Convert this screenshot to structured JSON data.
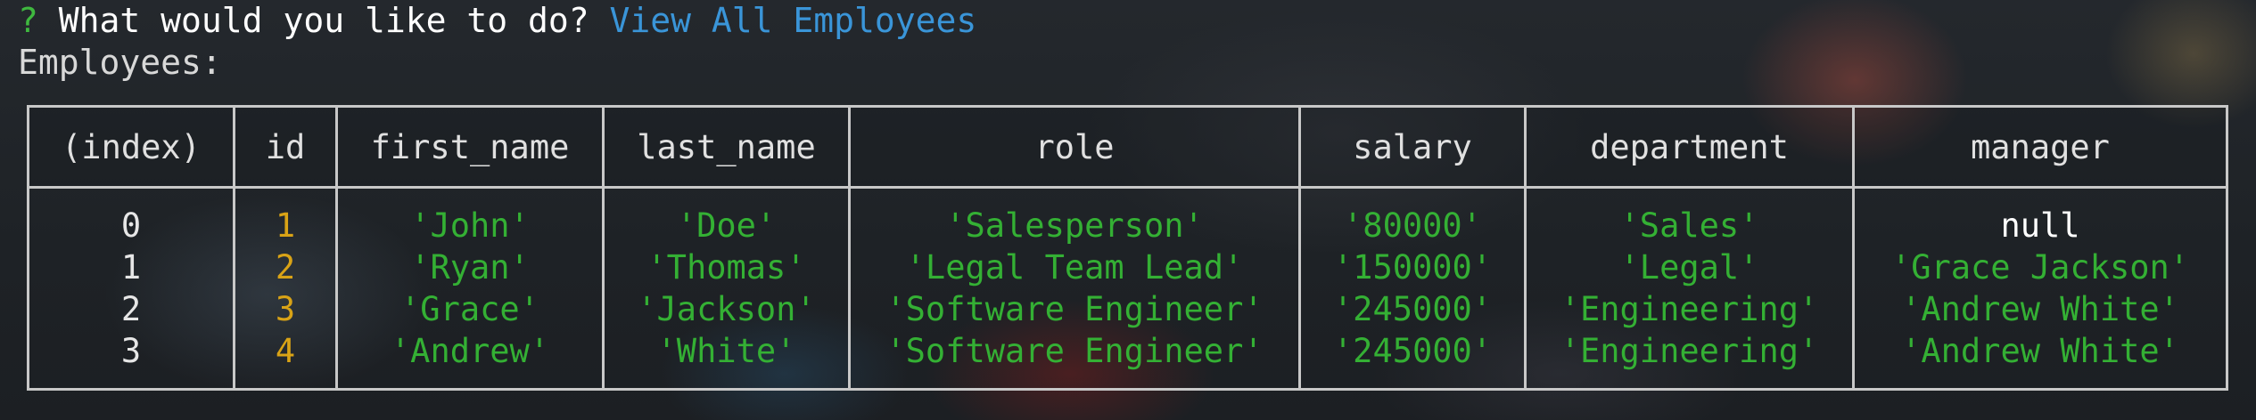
{
  "terminal": {
    "prompt_mark": "?",
    "prompt_question": "What would you like to do?",
    "prompt_answer": "View All Employees",
    "heading": "Employees:"
  },
  "table": {
    "columns": [
      "(index)",
      "id",
      "first_name",
      "last_name",
      "role",
      "salary",
      "department",
      "manager"
    ],
    "rows": [
      {
        "index": "0",
        "id": "1",
        "first_name": "'John'",
        "last_name": "'Doe'",
        "role": "'Salesperson'",
        "salary": "'80000'",
        "department": "'Sales'",
        "manager": "null"
      },
      {
        "index": "1",
        "id": "2",
        "first_name": "'Ryan'",
        "last_name": "'Thomas'",
        "role": "'Legal Team Lead'",
        "salary": "'150000'",
        "department": "'Legal'",
        "manager": "'Grace Jackson'"
      },
      {
        "index": "2",
        "id": "3",
        "first_name": "'Grace'",
        "last_name": "'Jackson'",
        "role": "'Software Engineer'",
        "salary": "'245000'",
        "department": "'Engineering'",
        "manager": "'Andrew White'"
      },
      {
        "index": "3",
        "id": "4",
        "first_name": "'Andrew'",
        "last_name": "'White'",
        "role": "'Software Engineer'",
        "salary": "'245000'",
        "department": "'Engineering'",
        "manager": "'Andrew White'"
      }
    ]
  },
  "colors": {
    "prompt_mark": "#3fb83f",
    "answer": "#3a95d8",
    "id_number": "#d9a316",
    "string_value": "#34b034",
    "border": "#c8c8c8"
  }
}
